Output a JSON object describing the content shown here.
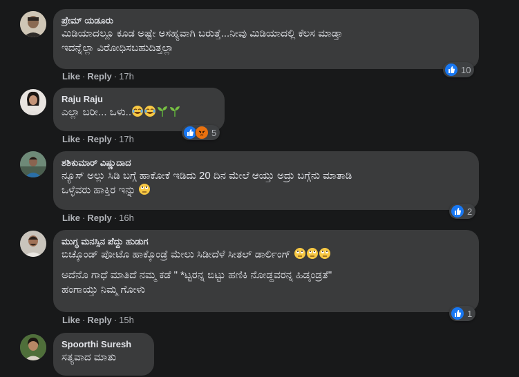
{
  "actions": {
    "like": "Like",
    "reply": "Reply",
    "separator": "·"
  },
  "comments": [
    {
      "author": "ಪ್ರೇಮ್ ಯಡೂರು",
      "lines": [
        "ಮಿಡಿಯಾದಲ್ಲೂ ಕೂಡ ಅಷ್ಟೇ ಅಸಹ್ಯವಾಗಿ ಬರುತ್ತೆ...ನೀವು ಮಿಡಿಯಾದಲ್ಲಿ ಕೆಲಸ ಮಾಡ್ತಾ\nಇದನ್ನೆಲ್ಲಾ ವಿರೋಧಿಸಬಹುದಿತ್ತಲ್ಲಾ"
      ],
      "time": "17h",
      "reactions": {
        "count": "10",
        "icons": [
          "like-icon"
        ]
      }
    },
    {
      "author": "Raju Raju",
      "lines": [
        "ಎಲ್ಲಾ ಬರೀ... ಒಳು.."
      ],
      "emojis": [
        "laughing-tears-icon",
        "laughing-tears-icon",
        "seedling-icon",
        "seedling-icon"
      ],
      "time": "17h",
      "reactions": {
        "count": "5",
        "icons": [
          "like-icon",
          "angry-icon"
        ]
      }
    },
    {
      "author": "ಶಶಿಕುಮಾರ್ ವಿಷ್ಣುದಾದ",
      "lines": [
        "ನ್ಯೂಸ್ ಅಲ್ಲು ಸಿಡಿ ಬಗ್ಗೆ ಹಾಕೋಕೆ ಇಡಿದು 20 ದಿನ ಮೇಲೆ ಆಯ್ತು ಅದ್ರು ಬಗ್ಗೆನು ಮಾತಾಡಿ\nಒಳ್ಳೆವರು ಹಾಕ್ತಿರ ಇನ್ನು"
      ],
      "emojis": [
        "eye-roll-icon"
      ],
      "time": "16h",
      "reactions": {
        "count": "2",
        "icons": [
          "like-icon"
        ]
      }
    },
    {
      "author": "ಮುಗ್ಧ ಮನಸ್ಸಿನ ಪೆದ್ದು ಹುಡುಗ",
      "lines": [
        "ಬಿಚ್ಕೊಂಡ್ ಪೋಟೊ ಹಾಕ್ಕೊಂಡ್ರೆ ಮೇಲು ಸಿಡೀದೆಳೆ ಸೀತಲ್ ಡಾರ್ಲಿಂಗ್",
        "ಅದೆನೊ ಗಾಧೆ ಮಾತಿದೆ ನಮ್ಮ ಕಡೆ \" *ಟ್ಟರನ್ನ ಬಿಟ್ಟು ಹಣಿಕಿ ನೋಡ್ದವರನ್ನ ಹಿಡ್ಕಂಡ್ರತೆ\"\nಹಂಗಾಯ್ತು ನಿಮ್ಮ ಗೋಳು"
      ],
      "emojis": [
        "eye-roll-icon",
        "eye-roll-icon",
        "eye-roll-icon"
      ],
      "time": "15h",
      "reactions": {
        "count": "1",
        "icons": [
          "like-icon"
        ]
      }
    },
    {
      "author": "Spoorthi Suresh",
      "lines": [
        "ಸತ್ಯವಾದ ಮಾತು"
      ]
    }
  ],
  "colors": {
    "background": "#18191a",
    "bubble": "#3a3b3c",
    "text": "#e4e6eb",
    "muted": "#b0b3b8",
    "like_blue": "#1877f2"
  }
}
